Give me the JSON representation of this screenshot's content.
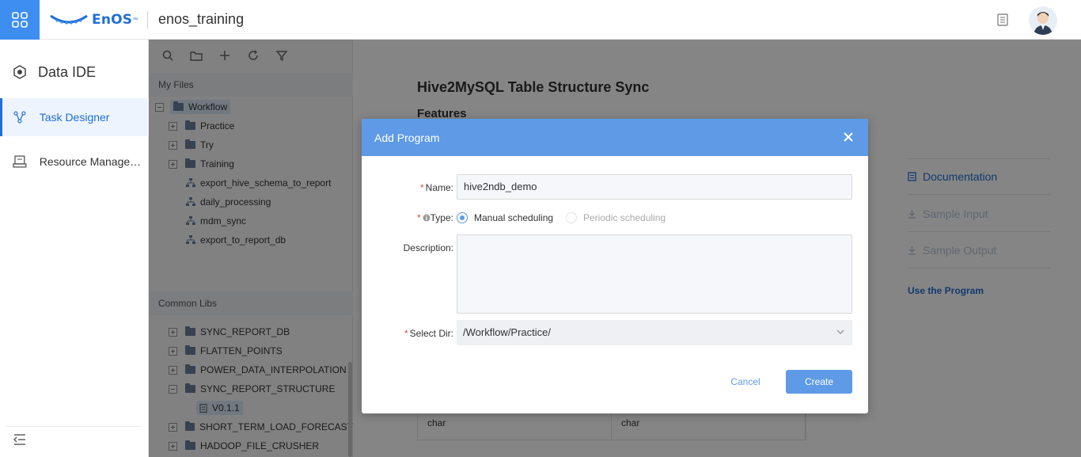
{
  "header": {
    "logo_text": "EnOS",
    "logo_tm": "™",
    "app_title": "enos_training"
  },
  "leftnav": {
    "title": "Data IDE",
    "items": [
      {
        "label": "Task Designer",
        "active": true
      },
      {
        "label": "Resource Management",
        "active": false
      }
    ]
  },
  "files": {
    "my_files_title": "My Files",
    "rows": [
      {
        "label": "Workflow",
        "type": "folder",
        "level": 0,
        "expanded": true,
        "selected": true
      },
      {
        "label": "Practice",
        "type": "folder",
        "level": 1,
        "expanded": false
      },
      {
        "label": "Try",
        "type": "folder",
        "level": 1,
        "expanded": false
      },
      {
        "label": "Training",
        "type": "folder",
        "level": 1,
        "expanded": false
      },
      {
        "label": "export_hive_schema_to_report",
        "type": "flow",
        "level": 1
      },
      {
        "label": "daily_processing",
        "type": "flow",
        "level": 1
      },
      {
        "label": "mdm_sync",
        "type": "flow",
        "level": 1
      },
      {
        "label": "export_to_report_db",
        "type": "flow",
        "level": 1
      }
    ],
    "common_libs_title": "Common Libs",
    "lib_rows": [
      {
        "label": "SYNC_REPORT_DB",
        "type": "folder",
        "expanded": false
      },
      {
        "label": "FLATTEN_POINTS",
        "type": "folder",
        "expanded": false
      },
      {
        "label": "POWER_DATA_INTERPOLATION",
        "type": "folder",
        "expanded": false
      },
      {
        "label": "SYNC_REPORT_STRUCTURE",
        "type": "folder",
        "expanded": true
      },
      {
        "label": "V0.1.1",
        "type": "version",
        "selected": true
      },
      {
        "label": "SHORT_TERM_LOAD_FORECAST",
        "type": "folder",
        "expanded": false
      },
      {
        "label": "HADOOP_FILE_CRUSHER",
        "type": "folder",
        "expanded": false
      }
    ]
  },
  "main": {
    "title": "Hive2MySQL Table Structure Sync",
    "subtitle": "Features",
    "side_links": [
      {
        "label": "Documentation",
        "enabled": true
      },
      {
        "label": "Sample Input",
        "enabled": false
      },
      {
        "label": "Sample Output",
        "enabled": false
      }
    ],
    "use_link": "Use the Program",
    "table_row": [
      "char",
      "char"
    ]
  },
  "modal": {
    "title": "Add Program",
    "name_label": "Name:",
    "name_value": "hive2ndb_demo",
    "type_label": "Type:",
    "type_options": [
      {
        "label": "Manual scheduling",
        "selected": true
      },
      {
        "label": "Periodic scheduling",
        "selected": false
      }
    ],
    "description_label": "Description:",
    "description_value": "",
    "dir_label": "Select Dir:",
    "dir_value": "/Workflow/Practice/",
    "cancel_label": "Cancel",
    "create_label": "Create",
    "required_mark": "*"
  },
  "colors": {
    "brand_blue": "#1f6fd6",
    "modal_header": "#5e9ae6",
    "app_button": "#3d8ef0"
  }
}
